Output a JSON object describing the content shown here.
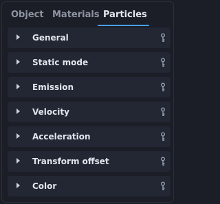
{
  "tabs": [
    {
      "label": "Object",
      "active": false
    },
    {
      "label": "Materials",
      "active": false
    },
    {
      "label": "Particles",
      "active": true
    }
  ],
  "sections": [
    {
      "label": "General",
      "icon": "key-icon"
    },
    {
      "label": "Static mode",
      "icon": "key-icon"
    },
    {
      "label": "Emission",
      "icon": "key-icon"
    },
    {
      "label": "Velocity",
      "icon": "key-icon"
    },
    {
      "label": "Acceleration",
      "icon": "key-icon"
    },
    {
      "label": "Transform offset",
      "icon": "key-icon"
    },
    {
      "label": "Color",
      "icon": "key-icon"
    }
  ],
  "colors": {
    "background": "#1b1e27",
    "section_bg": "#232733",
    "accent": "#4aa0ef",
    "text_active": "#e6e9ef",
    "text_inactive": "#8f95a3"
  }
}
